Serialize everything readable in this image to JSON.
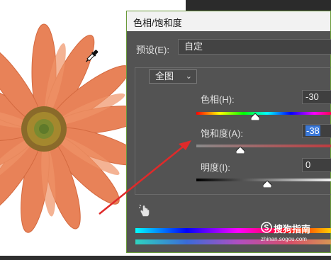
{
  "dialog": {
    "title": "色相/饱和度",
    "preset": {
      "label": "预设(E):",
      "value": "自定"
    },
    "range": {
      "value": "全图",
      "chevron_icon": "chevron-down-icon"
    },
    "sliders": [
      {
        "label": "色相(H):",
        "value": "-30",
        "amount": -30,
        "min": -180,
        "max": 180
      },
      {
        "label": "饱和度(A):",
        "value": "-38",
        "amount": -38,
        "min": -100,
        "max": 100
      },
      {
        "label": "明度(I):",
        "value": "0",
        "amount": 0,
        "min": -100,
        "max": 100
      }
    ],
    "tool_icon": "targeted-adjustment-hand-icon"
  },
  "canvas": {
    "image": "orange-daisy-flower",
    "cursor_icon": "eyedropper-icon",
    "annotation_color": "#e02a2a"
  },
  "watermark": {
    "text": "搜狗指南",
    "url": "zhinan.sogou.com"
  }
}
